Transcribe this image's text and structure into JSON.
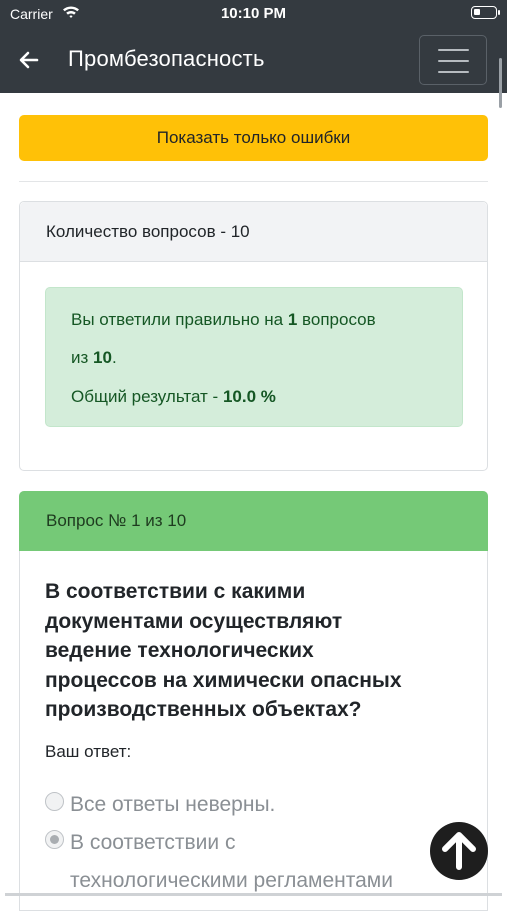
{
  "status_bar": {
    "carrier": "Carrier",
    "time": "10:10 PM"
  },
  "navbar": {
    "back_icon": "arrow-left-icon",
    "title": "Промбезопасность",
    "menu_icon": "hamburger-menu-icon"
  },
  "actions": {
    "show_errors_label": "Показать только ошибки"
  },
  "summary_card": {
    "header": "Количество вопросов - 10",
    "alert": {
      "line1_prefix": "Вы ответили правильно на ",
      "correct_count": "1",
      "line1_suffix": " вопросов",
      "line2_prefix": "из ",
      "total": "10",
      "line2_suffix": ".",
      "line3_prefix": "Общий результат - ",
      "percent": "10.0 %"
    }
  },
  "question_card": {
    "header": "Вопрос № 1 из 10",
    "question_lines": [
      "В соответствии с какими",
      "документами осуществляют",
      "ведение технологических",
      "процессов на химически опасных",
      "производственных объектах?"
    ],
    "your_answer_label": "Ваш ответ:",
    "options": [
      {
        "lines": [
          "Все ответы неверны."
        ],
        "selected": false
      },
      {
        "lines": [
          "В соответствии с",
          "технологическими регламентами"
        ],
        "selected": true
      }
    ]
  },
  "fab": {
    "icon": "arrow-up-icon"
  },
  "colors": {
    "navbar_bg": "#343a40",
    "warning_button": "#ffc107",
    "success_alert_bg": "#d4edda",
    "success_text": "#155724",
    "question_header_bg": "#75c977"
  }
}
